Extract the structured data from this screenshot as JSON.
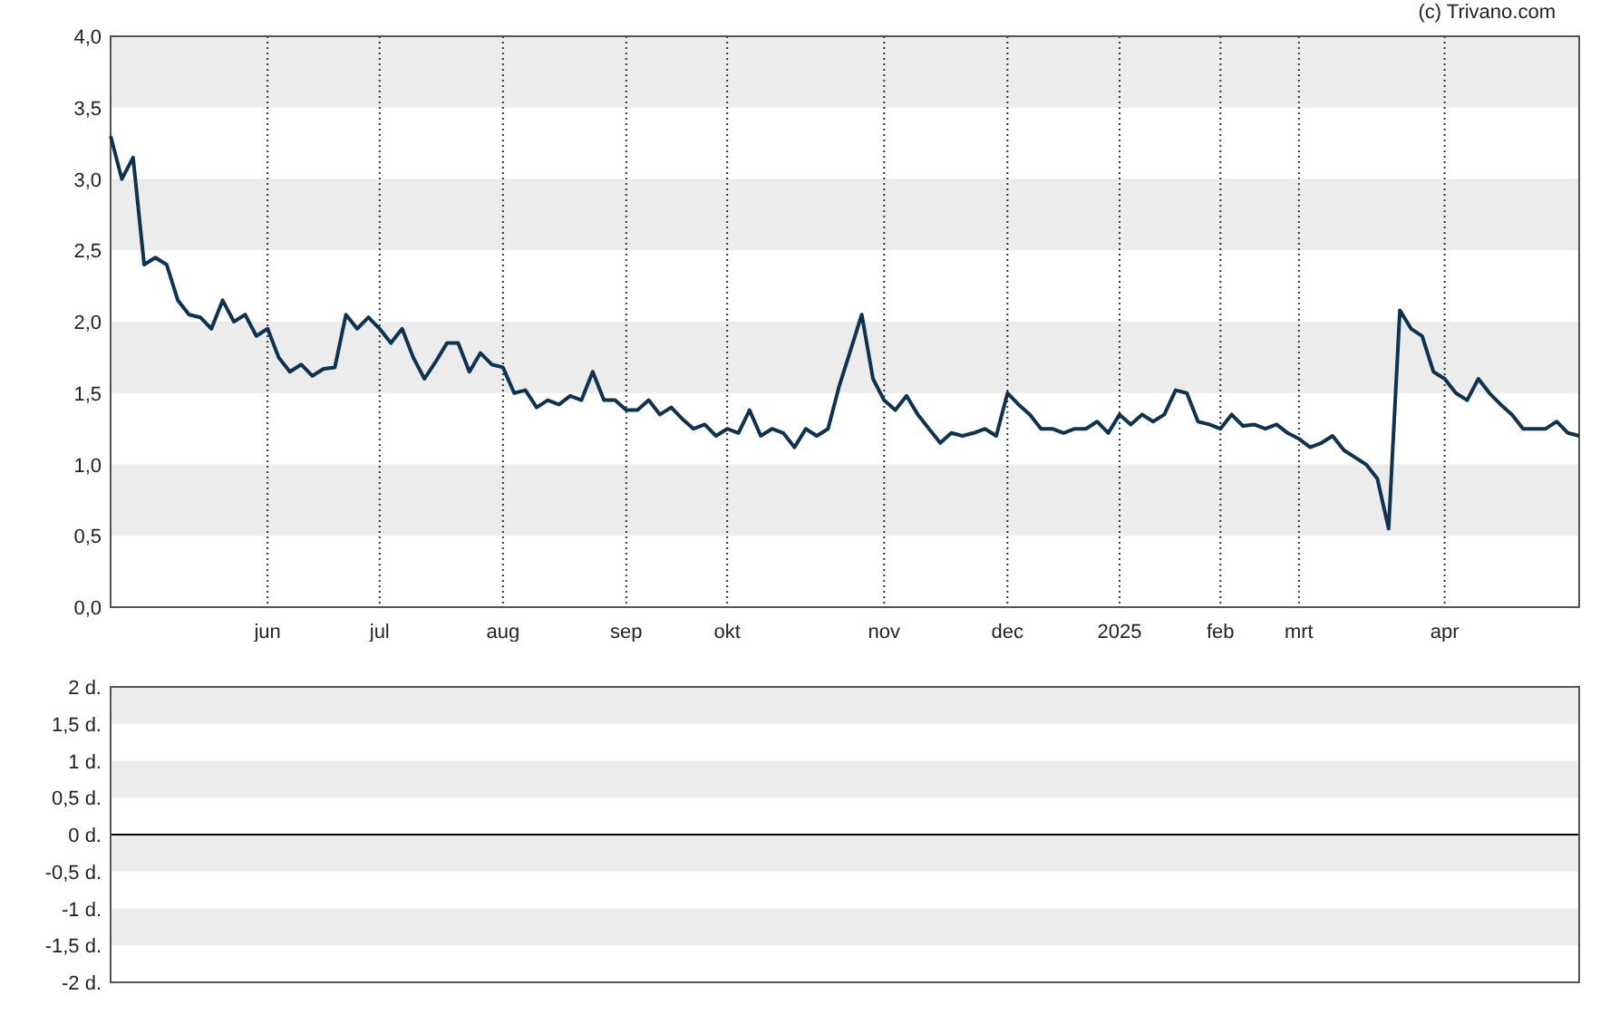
{
  "credit": "(c) Trivano.com",
  "price_chart": {
    "chart_data": {
      "type": "line",
      "ylim": [
        0,
        4
      ],
      "yticks": [
        {
          "value": 0,
          "label": "0,0"
        },
        {
          "value": 0.5,
          "label": "0,5"
        },
        {
          "value": 1,
          "label": "1,0"
        },
        {
          "value": 1.5,
          "label": "1,5"
        },
        {
          "value": 2,
          "label": "2,0"
        },
        {
          "value": 2.5,
          "label": "2,5"
        },
        {
          "value": 3,
          "label": "3,0"
        },
        {
          "value": 3.5,
          "label": "3,5"
        },
        {
          "value": 4,
          "label": "4,0"
        }
      ],
      "categories": [
        null,
        null,
        null,
        null,
        null,
        null,
        null,
        null,
        null,
        null,
        null,
        null,
        null,
        null,
        "jun",
        null,
        null,
        null,
        null,
        null,
        null,
        null,
        null,
        null,
        "jul",
        null,
        null,
        null,
        null,
        null,
        null,
        null,
        null,
        null,
        null,
        "aug",
        null,
        null,
        null,
        null,
        null,
        null,
        null,
        null,
        null,
        null,
        "sep",
        null,
        null,
        null,
        null,
        null,
        null,
        null,
        null,
        "okt",
        null,
        null,
        null,
        null,
        null,
        null,
        null,
        null,
        null,
        null,
        null,
        null,
        null,
        "nov",
        null,
        null,
        null,
        null,
        null,
        null,
        null,
        null,
        null,
        null,
        "dec",
        null,
        null,
        null,
        null,
        null,
        null,
        null,
        null,
        null,
        "2025",
        null,
        null,
        null,
        null,
        null,
        null,
        null,
        null,
        "feb",
        null,
        null,
        null,
        null,
        null,
        null,
        "mrt",
        null,
        null,
        null,
        null,
        null,
        null,
        null,
        null,
        null,
        null,
        null,
        null,
        "apr",
        null,
        null,
        null,
        null,
        null,
        null,
        null,
        null,
        null,
        null,
        null,
        null
      ],
      "series": [
        {
          "color": "#0d3350",
          "values": [
            3.3,
            3.0,
            3.15,
            2.4,
            2.45,
            2.4,
            2.15,
            2.05,
            2.03,
            1.95,
            2.15,
            2.0,
            2.05,
            1.9,
            1.95,
            1.75,
            1.65,
            1.7,
            1.62,
            1.67,
            1.68,
            2.05,
            1.95,
            2.03,
            1.95,
            1.85,
            1.95,
            1.75,
            1.6,
            1.72,
            1.85,
            1.85,
            1.65,
            1.78,
            1.7,
            1.68,
            1.5,
            1.52,
            1.4,
            1.45,
            1.42,
            1.48,
            1.45,
            1.65,
            1.45,
            1.45,
            1.38,
            1.38,
            1.45,
            1.35,
            1.4,
            1.32,
            1.25,
            1.28,
            1.2,
            1.25,
            1.22,
            1.38,
            1.2,
            1.25,
            1.22,
            1.12,
            1.25,
            1.2,
            1.25,
            1.55,
            1.8,
            2.05,
            1.6,
            1.45,
            1.38,
            1.48,
            1.35,
            1.25,
            1.15,
            1.22,
            1.2,
            1.22,
            1.25,
            1.2,
            1.5,
            1.42,
            1.35,
            1.25,
            1.25,
            1.22,
            1.25,
            1.25,
            1.3,
            1.22,
            1.35,
            1.28,
            1.35,
            1.3,
            1.35,
            1.52,
            1.5,
            1.3,
            1.28,
            1.25,
            1.35,
            1.27,
            1.28,
            1.25,
            1.28,
            1.22,
            1.18,
            1.12,
            1.15,
            1.2,
            1.1,
            1.05,
            1.0,
            0.9,
            0.55,
            2.08,
            1.95,
            1.9,
            1.65,
            1.6,
            1.5,
            1.45,
            1.6,
            1.5,
            1.42,
            1.35,
            1.25,
            1.25,
            1.25,
            1.3,
            1.22,
            1.2
          ]
        }
      ]
    }
  },
  "volume_chart": {
    "axis_labels": [
      "2 d.",
      "1,5 d.",
      "1 d.",
      "0,5 d.",
      "0 d.",
      "-0,5 d.",
      "-1 d.",
      "-1,5 d.",
      "-2 d."
    ]
  }
}
